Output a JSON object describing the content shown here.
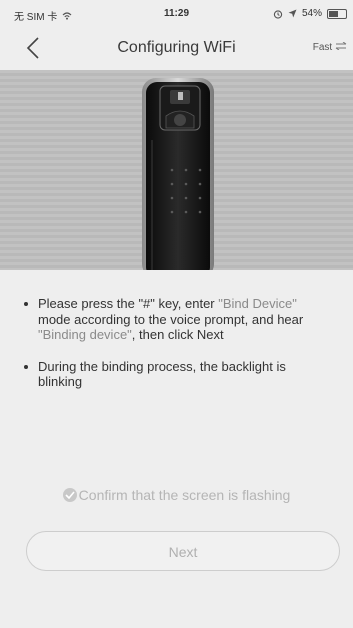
{
  "status_bar": {
    "carrier": "无 SIM 卡",
    "time": "11:29",
    "battery": "54%",
    "battery_level": 0.54
  },
  "nav": {
    "title": "Configuring WiFi",
    "fast_label": "Fast",
    "fast_icon": "switch-arrows-icon",
    "back_icon": "chevron-left-icon"
  },
  "hero": {
    "image": "smart-door-lock-illustration"
  },
  "instructions": {
    "item1": {
      "part1": "Please press the \"#\" key, enter ",
      "highlight1": "\"Bind Device\"",
      "part2": " mode according to the voice prompt, and hear ",
      "highlight2": "\"Binding device\"",
      "part3": ", then click Next"
    },
    "item2": "During the binding process, the backlight is blinking"
  },
  "confirm": {
    "label": "Confirm that the screen is flashing",
    "checked": false
  },
  "next_button": {
    "label": "Next",
    "enabled": false
  }
}
